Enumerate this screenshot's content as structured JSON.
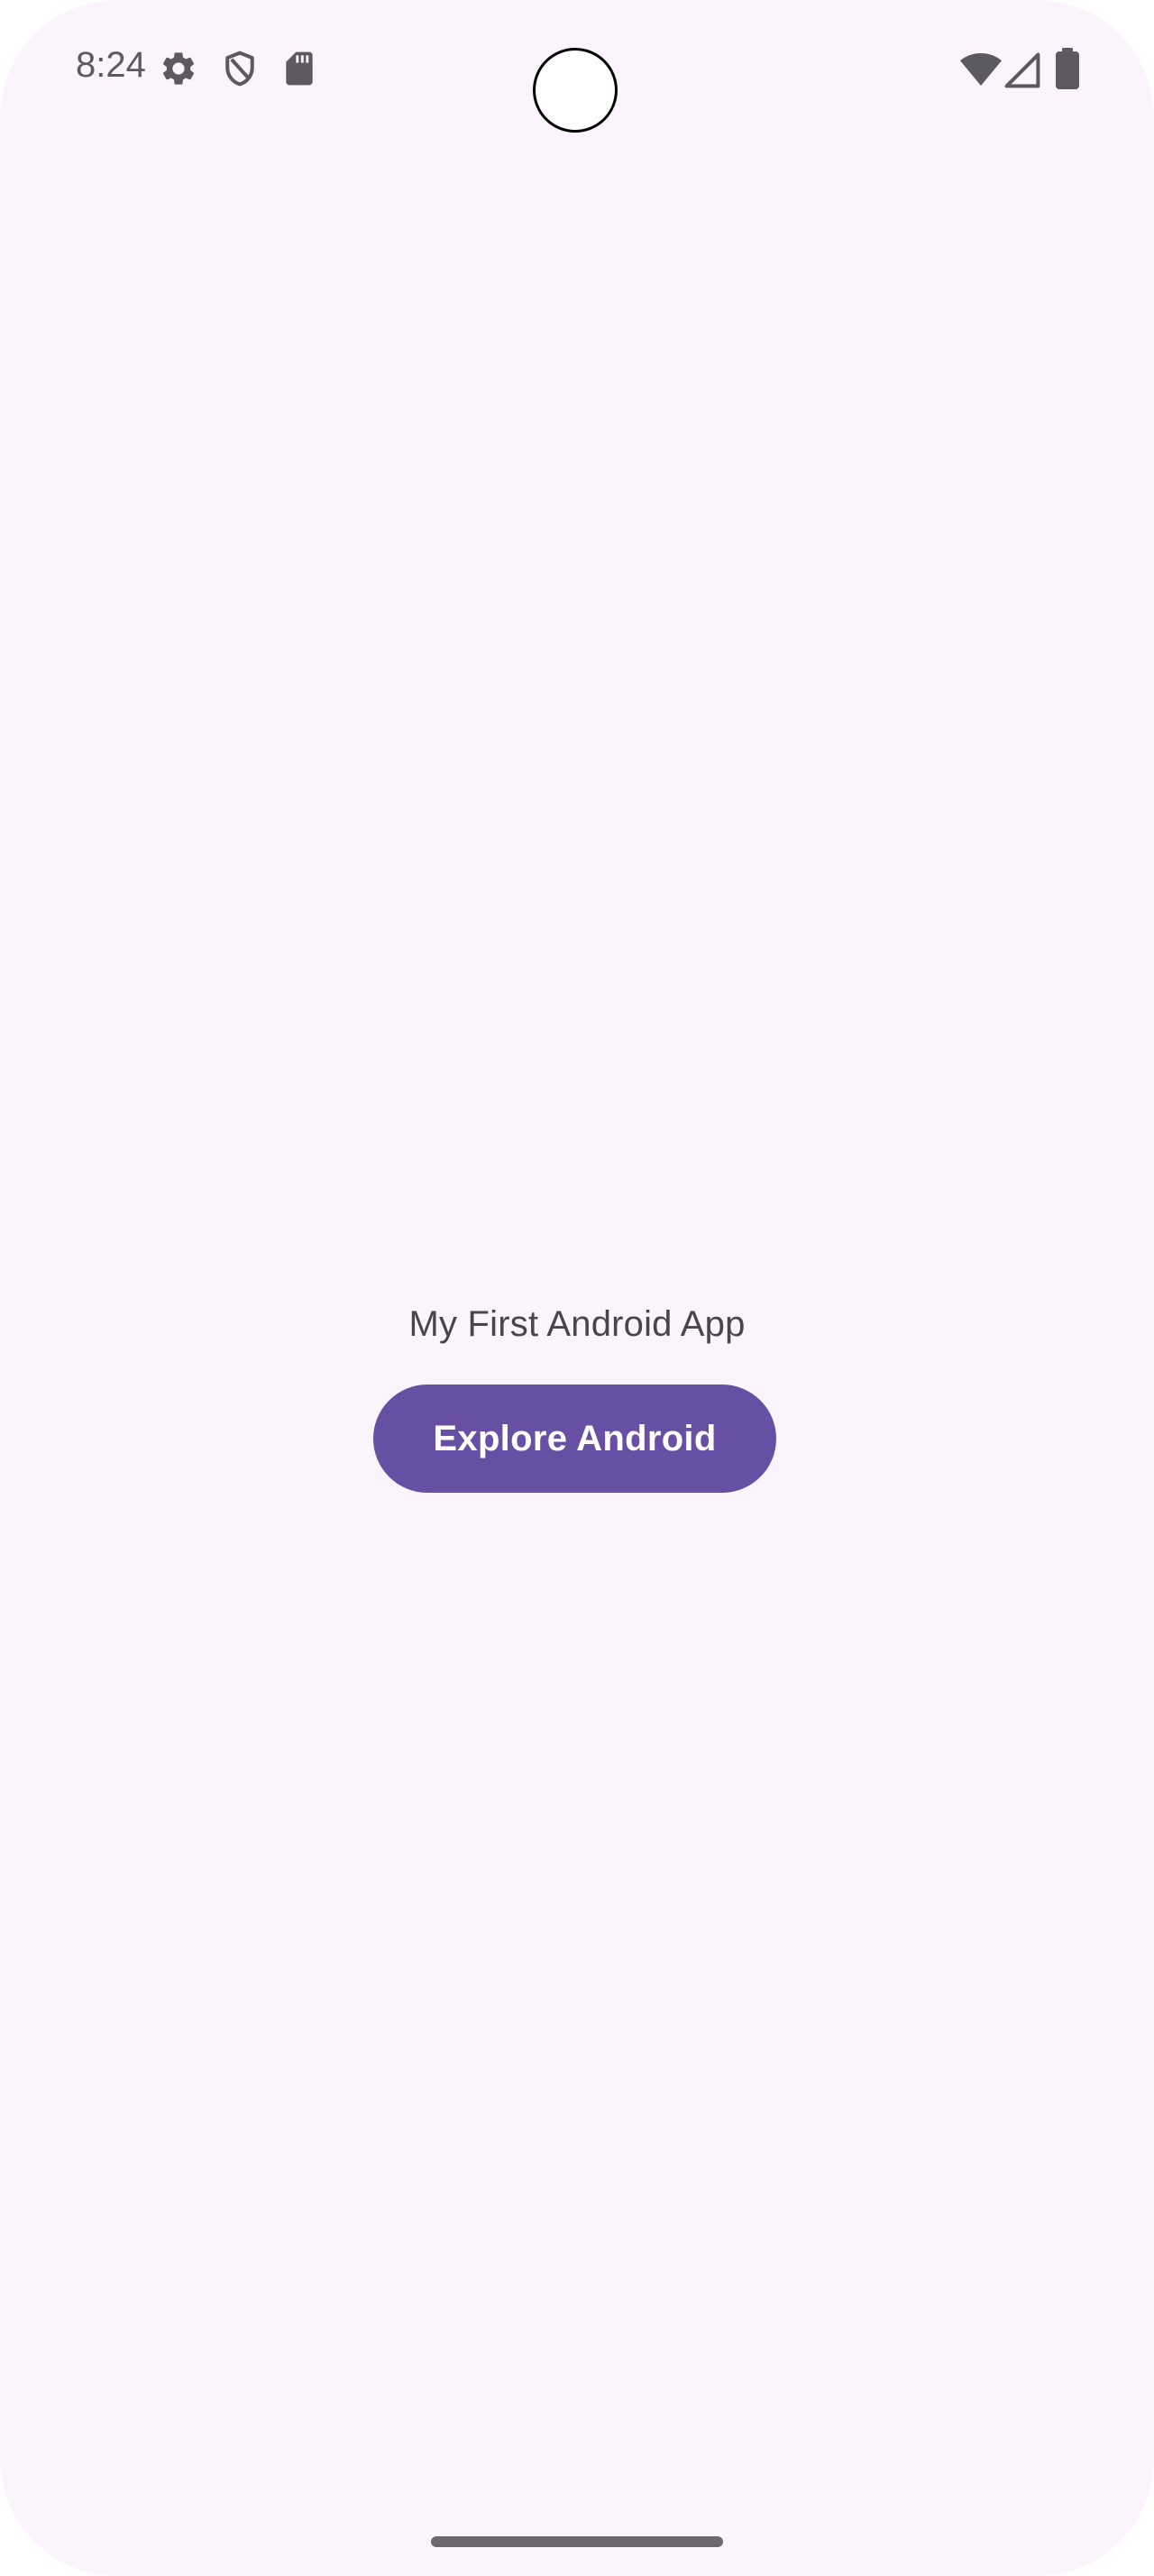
{
  "status_bar": {
    "time": "8:24",
    "left_icons": [
      "gear-icon",
      "shield-icon",
      "sd-card-icon"
    ],
    "right_icons": [
      "wifi-icon",
      "cell-signal-icon",
      "battery-icon"
    ],
    "icon_color": "#5d5962"
  },
  "main": {
    "title": "My First Android App",
    "button_label": "Explore Android"
  },
  "colors": {
    "background": "#fcf4fc",
    "accent": "#6750a4",
    "text": "#49454f"
  }
}
